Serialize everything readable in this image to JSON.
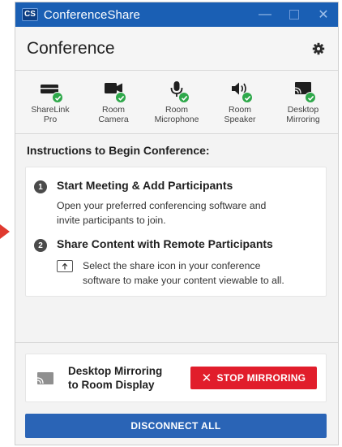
{
  "window": {
    "badge": "CS",
    "title": "ConferenceShare",
    "controls": [
      "minimize-icon",
      "maximize-icon",
      "close-icon"
    ]
  },
  "header": {
    "title": "Conference",
    "settings_icon": "gear-icon"
  },
  "devices": [
    {
      "label": "ShareLink\nPro",
      "icon": "sharelink-device-icon",
      "status": "connected"
    },
    {
      "label": "Room\nCamera",
      "icon": "camera-icon",
      "status": "connected"
    },
    {
      "label": "Room\nMicrophone",
      "icon": "microphone-icon",
      "status": "connected"
    },
    {
      "label": "Room\nSpeaker",
      "icon": "speaker-icon",
      "status": "connected"
    },
    {
      "label": "Desktop\nMirroring",
      "icon": "cast-icon",
      "status": "connected"
    }
  ],
  "instructions": {
    "title": "Instructions to Begin Conference:",
    "steps": [
      {
        "number": "1",
        "title": "Start Meeting & Add Participants",
        "body_line1": "Open your preferred conferencing software and",
        "body_line2": "invite participants to join."
      },
      {
        "number": "2",
        "title": "Share Content with Remote Participants",
        "body_line1": "Select the share icon in your conference",
        "body_line2": "software to make your content viewable to all."
      }
    ]
  },
  "mirroring": {
    "label": "Desktop Mirroring\nto Room Display",
    "icon": "cast-icon",
    "stop_label": "STOP MIRRORING"
  },
  "disconnect_label": "DISCONNECT ALL",
  "colors": {
    "titlebar": "#1a5fb4",
    "stop": "#e11d2b",
    "disconnect": "#2a64b6",
    "status_ok": "#2ea84a"
  }
}
